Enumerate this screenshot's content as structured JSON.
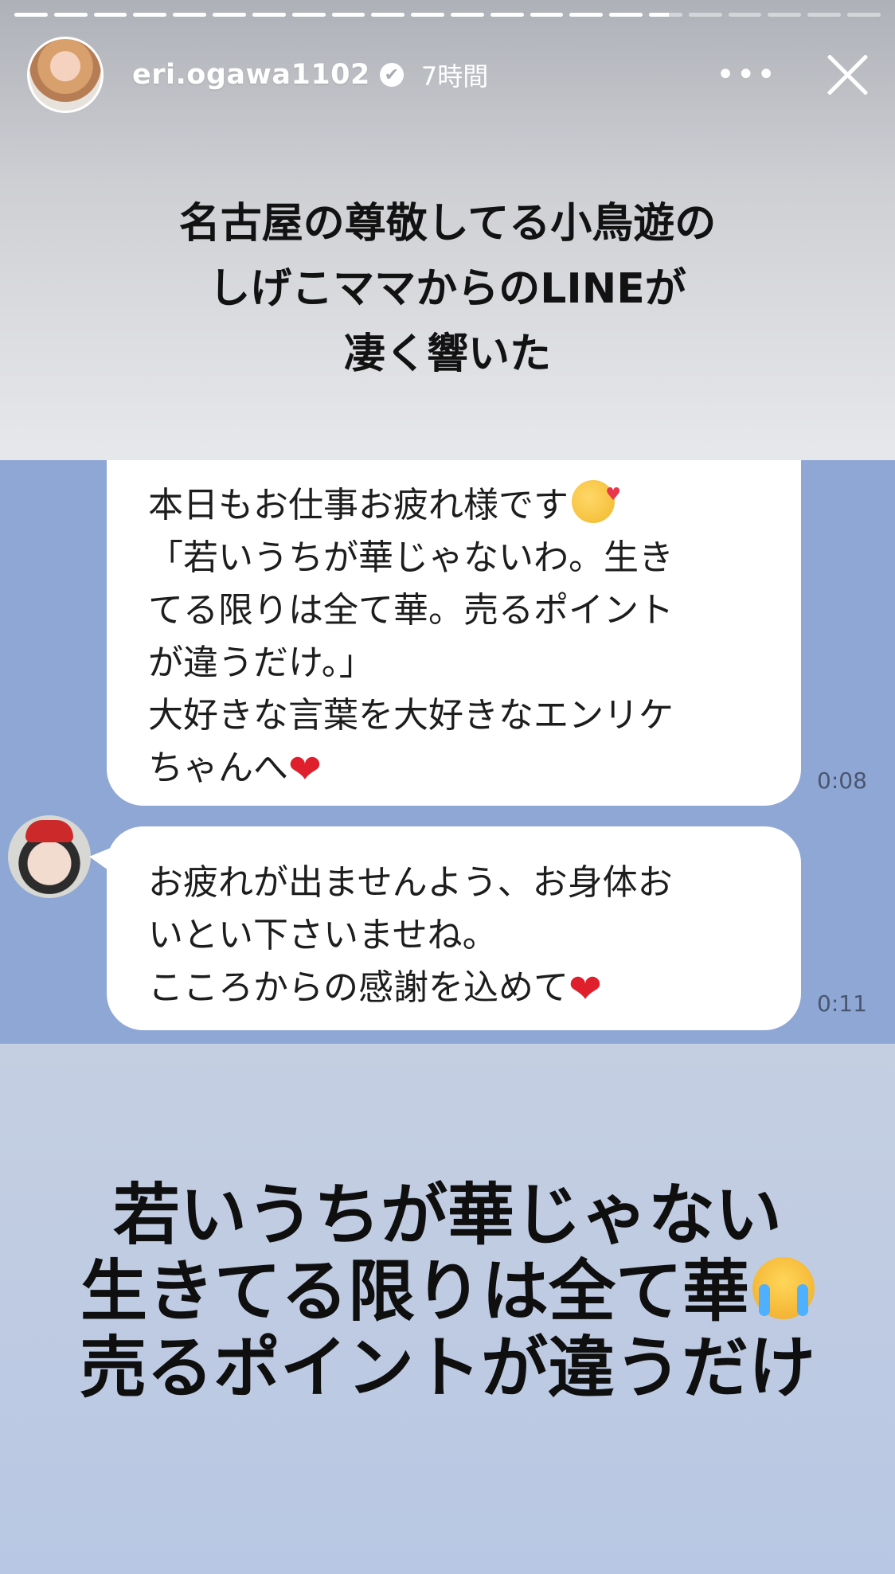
{
  "story": {
    "progress": [
      1,
      1,
      1,
      1,
      1,
      1,
      1,
      1,
      1,
      1,
      1,
      1,
      1,
      1,
      1,
      1,
      0.6,
      0,
      0,
      0,
      0,
      0
    ]
  },
  "header": {
    "username": "eri.ogawa1102",
    "verified_icon": "✔",
    "time": "7時間",
    "more_label": "•••"
  },
  "caption_top": {
    "line1": "名古屋の尊敬してる小鳥遊の",
    "line2": "しげこママからのLINEが",
    "line3": "凄く響いた"
  },
  "line_chat": {
    "message1": {
      "line1": "本日もお仕事お疲れ様です",
      "line2": "「若いうちが華じゃないわ。生き",
      "line3": "てる限りは全て華。売るポイント",
      "line4": "が違うだけ。」",
      "line5": "大好きな言葉を大好きなエンリケ",
      "line6": "ちゃんへ",
      "heart": "❤",
      "time": "0:08"
    },
    "message2": {
      "line1": "お疲れが出ませんよう、お身体お",
      "line2": "いとい下さいませね。",
      "line3": "こころからの感謝を込めて",
      "heart": "❤",
      "time": "0:11"
    }
  },
  "caption_bottom": {
    "line1": "若いうちが華じゃない",
    "line2": "生きてる限りは全て華",
    "line3": "売るポイントが違うだけ"
  }
}
